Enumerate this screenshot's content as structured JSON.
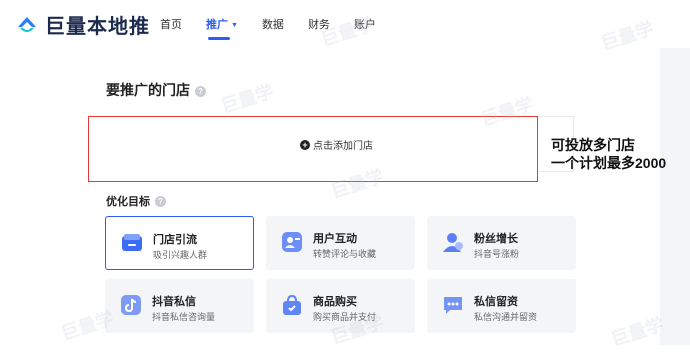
{
  "brand": {
    "name": "巨量本地推"
  },
  "nav": [
    {
      "label": "首页",
      "active": false
    },
    {
      "label": "推广",
      "active": true
    },
    {
      "label": "数据",
      "active": false
    },
    {
      "label": "财务",
      "active": false
    },
    {
      "label": "账户",
      "active": false
    }
  ],
  "store_section": {
    "title": "要推广的门店",
    "add_button": "点击添加门店"
  },
  "annotation": {
    "line1": "可投放多门店",
    "line2": "一个计划最多2000"
  },
  "goals": {
    "title": "优化目标",
    "cards": [
      {
        "title": "门店引流",
        "subtitle": "吸引兴趣人群",
        "icon": "store-icon",
        "selected": true,
        "color": "#3b6cf6"
      },
      {
        "title": "用户互动",
        "subtitle": "转赞评论与收藏",
        "icon": "user-card-icon",
        "selected": false,
        "color": "#6b8ef7"
      },
      {
        "title": "粉丝增长",
        "subtitle": "抖音号涨粉",
        "icon": "user-icon",
        "selected": false,
        "color": "#5b7ff5"
      },
      {
        "title": "抖音私信",
        "subtitle": "抖音私信咨询量",
        "icon": "douyin-message-icon",
        "selected": false,
        "color": "#7d9af6"
      },
      {
        "title": "商品购买",
        "subtitle": "购买商品并支付",
        "icon": "shopping-bag-icon",
        "selected": false,
        "color": "#5e86f5"
      },
      {
        "title": "私信留资",
        "subtitle": "私信沟通并留资",
        "icon": "chat-icon",
        "selected": false,
        "color": "#7494f6"
      }
    ]
  },
  "watermark": "巨量学"
}
